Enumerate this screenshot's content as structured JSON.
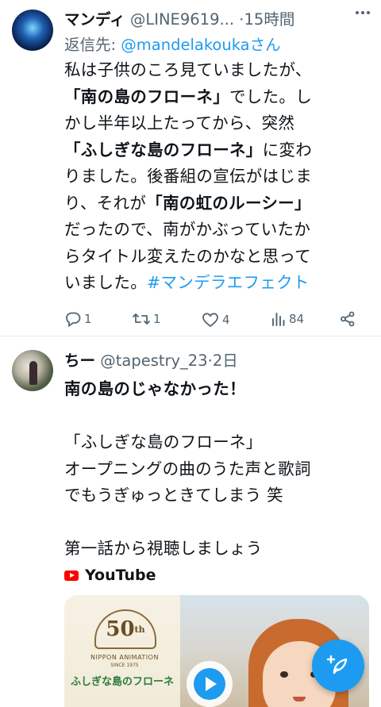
{
  "tweets": [
    {
      "name": "マンディ",
      "handle": "@LINE9619...",
      "time": "15時間",
      "reply_prefix": "返信先:",
      "reply_mention": "@mandelakouka",
      "reply_suffix": "さん",
      "body": {
        "l1": "私は子供のころ見ていましたが、",
        "l2a": "「南の島のフローネ」",
        "l2b": "でした。し",
        "l3": "かし半年以上たってから、突然",
        "l4a": "「ふしぎな島のフローネ」",
        "l4b": "に変わ",
        "l5": "りました。後番組の宣伝がはじま",
        "l6a": "り、それが",
        "l6b": "「南の虹のルーシー」",
        "l7": "だったので、南がかぶっていたか",
        "l8": "らタイトル変えたのかなと思って",
        "l9a": "いました。",
        "l9b": "#マンデラエフェクト"
      },
      "actions": {
        "replies": "1",
        "retweets": "1",
        "likes": "4",
        "views": "84"
      }
    },
    {
      "name": "ちー",
      "handle": "@tapestry_23",
      "time": "2日",
      "body": {
        "l1": "南の島のじゃなかった！",
        "l2": "「ふしぎな島のフローネ」",
        "l3": "オープニングの曲のうた声と歌詞",
        "l4": "でもうぎゅっときてしまう 笑",
        "l5": "第一話から視聴しましょう"
      },
      "link_source": "YouTube",
      "card": {
        "badge": "50",
        "badge_sup": "th",
        "studio": "NIPPON ANIMATION",
        "since": "SINCE 1975",
        "show_title": "ふしぎな島のフローネ"
      }
    }
  ],
  "colors": {
    "accent": "#1d9bf0",
    "text": "#0f1419",
    "muted": "#536471",
    "divider": "#e6e9ec",
    "youtube_red": "#ff0000"
  }
}
